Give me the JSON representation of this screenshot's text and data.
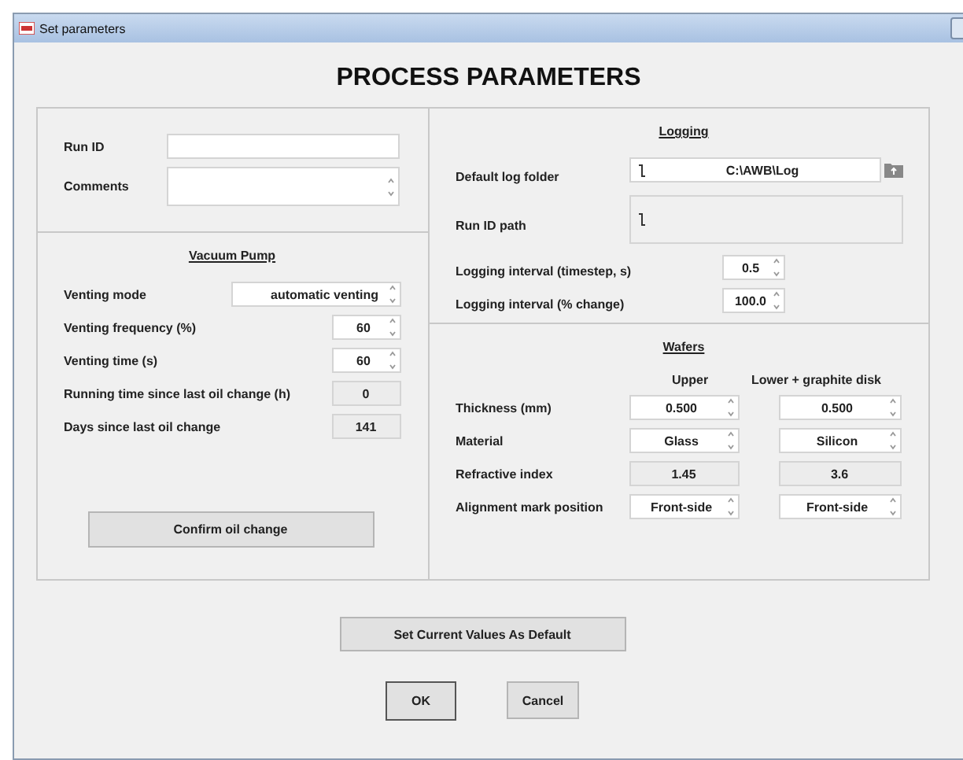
{
  "window": {
    "title": "Set parameters"
  },
  "heading": "PROCESS PARAMETERS",
  "run_info": [
    {
      "label": "Run ID",
      "kind": "text"
    },
    {
      "label": "Comments",
      "kind": "textarea"
    }
  ],
  "vacuum_pump": {
    "title": "Vacuum Pump",
    "rows": [
      {
        "label": "Venting mode",
        "kind": "dropdown",
        "value": "automatic venting"
      },
      {
        "label": "Venting frequency (%)",
        "kind": "spin",
        "value": "60"
      },
      {
        "label": "Venting time (s)",
        "kind": "spin",
        "value": "60"
      },
      {
        "label": "Running time since last oil change (h)",
        "kind": "readout",
        "value": "0"
      },
      {
        "label": "Days since last oil change",
        "kind": "readout",
        "value": "141"
      }
    ],
    "confirm_button": "Confirm oil change"
  },
  "logging": {
    "title": "Logging",
    "default_log_folder": {
      "label": "Default log folder",
      "value": "C:\\AWB\\Log"
    },
    "run_id_path": {
      "label": "Run ID path"
    },
    "rows": [
      {
        "label": "Logging interval (timestep, s)",
        "value": "0.5"
      },
      {
        "label": "Logging interval (% change)",
        "value": "100.0"
      }
    ]
  },
  "wafers": {
    "title": "Wafers",
    "columns": [
      "Upper",
      "Lower + graphite disk"
    ],
    "rows": [
      {
        "label": "Thickness (mm)",
        "kind": "spin",
        "values": [
          "0.500",
          "0.500"
        ]
      },
      {
        "label": "Material",
        "kind": "spin",
        "values": [
          "Glass",
          "Silicon"
        ]
      },
      {
        "label": "Refractive index",
        "kind": "readout",
        "values": [
          "1.45",
          "3.6"
        ]
      },
      {
        "label": "Alignment mark position",
        "kind": "spin",
        "values": [
          "Front-side",
          "Front-side"
        ]
      }
    ]
  },
  "buttons": {
    "set_default": "Set Current Values As Default",
    "ok": "OK",
    "cancel": "Cancel"
  }
}
